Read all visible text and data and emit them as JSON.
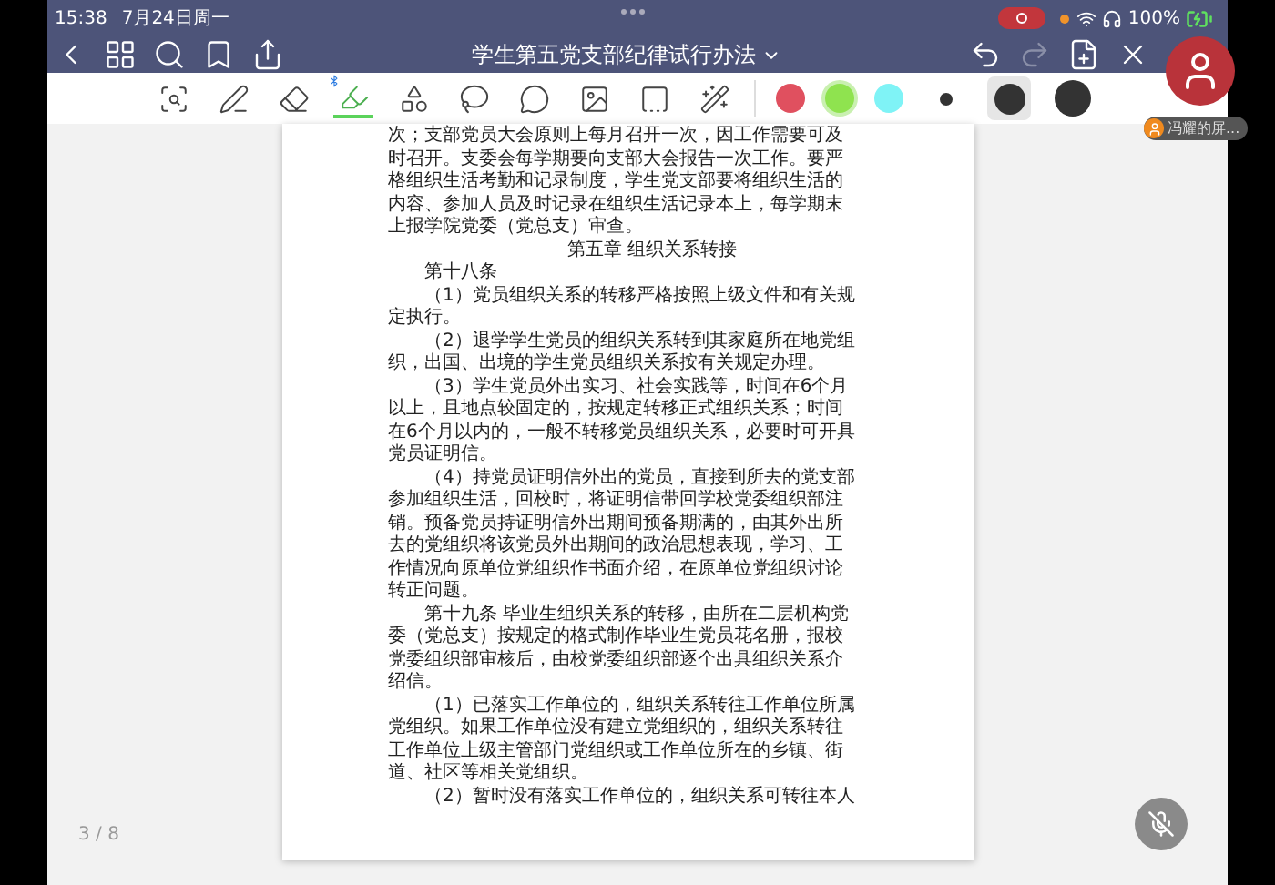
{
  "status_bar": {
    "time": "15:38",
    "date": "7月24日周一",
    "battery": "100%"
  },
  "nav": {
    "title": "学生第五党支部纪律试行办法"
  },
  "tools": [
    {
      "kind": "zoom",
      "selected": false
    },
    {
      "kind": "pen",
      "selected": false
    },
    {
      "kind": "eraser",
      "selected": false
    },
    {
      "kind": "highlighter",
      "selected": true
    },
    {
      "kind": "shapes",
      "selected": false
    },
    {
      "kind": "lasso",
      "selected": false
    },
    {
      "kind": "sticker",
      "selected": false
    },
    {
      "kind": "image",
      "selected": false
    },
    {
      "kind": "text",
      "selected": false
    },
    {
      "kind": "laser",
      "selected": false
    }
  ],
  "colors": [
    {
      "color": "#e0505f",
      "selected": false
    },
    {
      "color": "#8fe34f",
      "selected": true
    },
    {
      "color": "#7ff3f6",
      "selected": false
    }
  ],
  "sizes": [
    {
      "kind": "small",
      "selected": false
    },
    {
      "kind": "medium",
      "selected": true
    },
    {
      "kind": "large",
      "selected": false
    }
  ],
  "share_tag": "冯耀的屏...",
  "document": [
    {
      "kind": "body",
      "lines": [
        "次；支部党员大会原则上每月召开一次，因工作需要可及",
        "时召开。支委会每学期要向支部大会报告一次工作。要严",
        "格组织生活考勤和记录制度，学生党支部要将组织生活的",
        "内容、参加人员及时记录在组织生活记录本上，每学期末",
        "上报学院党委（党总支）审查。"
      ]
    },
    {
      "kind": "heading",
      "lines": [
        "第五章 组织关系转接"
      ]
    },
    {
      "kind": "indented",
      "lines": [
        "第十八条"
      ]
    },
    {
      "kind": "indented",
      "lines": [
        "（1）党员组织关系的转移严格按照上级文件和有关规",
        "定执行。"
      ]
    },
    {
      "kind": "indented",
      "lines": [
        "（2）退学学生党员的组织关系转到其家庭所在地党组",
        "织，出国、出境的学生党员组织关系按有关规定办理。"
      ]
    },
    {
      "kind": "indented",
      "lines": [
        "（3）学生党员外出实习、社会实践等，时间在6个月",
        "以上，且地点较固定的，按规定转移正式组织关系；时间",
        "在6个月以内的，一般不转移党员组织关系，必要时可开具",
        "党员证明信。"
      ]
    },
    {
      "kind": "indented",
      "lines": [
        "（4）持党员证明信外出的党员，直接到所去的党支部",
        "参加组织生活，回校时，将证明信带回学校党委组织部注",
        "销。预备党员持证明信外出期间预备期满的，由其外出所",
        "去的党组织将该党员外出期间的政治思想表现，学习、工",
        "作情况向原单位党组织作书面介绍，在原单位党组织讨论",
        "转正问题。"
      ]
    },
    {
      "kind": "indented",
      "lines": [
        "第十九条 毕业生组织关系的转移，由所在二层机构党",
        "委（党总支）按规定的格式制作毕业生党员花名册，报校",
        "党委组织部审核后，由校党委组织部逐个出具组织关系介",
        "绍信。"
      ]
    },
    {
      "kind": "indented",
      "lines": [
        "（1）已落实工作单位的，组织关系转往工作单位所属",
        "党组织。如果工作单位没有建立党组织的，组织关系转往",
        "工作单位上级主管部门党组织或工作单位所在的乡镇、街",
        "道、社区等相关党组织。"
      ]
    },
    {
      "kind": "indented",
      "lines": [
        "（2）暂时没有落实工作单位的，组织关系可转往本人"
      ]
    }
  ],
  "page_indicator": "3 / 8"
}
